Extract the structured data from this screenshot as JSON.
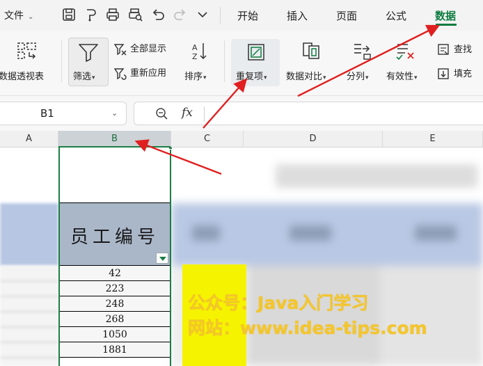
{
  "menubar": {
    "file_label": "文件",
    "tabs": [
      {
        "label": "开始"
      },
      {
        "label": "插入"
      },
      {
        "label": "页面"
      },
      {
        "label": "公式"
      },
      {
        "label": "数据",
        "active": true
      }
    ]
  },
  "ribbon": {
    "pivot_label": "数据透视表",
    "filter_label": "筛选",
    "show_all_label": "全部显示",
    "reapply_label": "重新应用",
    "sort_label": "排序",
    "duplicate_label": "重复项",
    "compare_label": "数据对比",
    "split_label": "分列",
    "validity_label": "有效性",
    "lookup_label": "查找",
    "fill_label": "填充"
  },
  "formula_bar": {
    "cell_ref": "B1",
    "fx_label": "fx"
  },
  "columns": [
    "A",
    "B",
    "C",
    "D",
    "E"
  ],
  "sheet": {
    "header_text": "员工编号",
    "values": [
      "42",
      "223",
      "248",
      "268",
      "1050",
      "1881"
    ]
  },
  "watermark": {
    "line1": "公众号：Java入门学习",
    "line2": "网站：www.idea-tips.com"
  },
  "colors": {
    "accent": "#0c7c3f",
    "arrow": "#e02020",
    "header_fill": "#aab7c9",
    "highlight_yellow": "#f6f300",
    "watermark": "#f4c62e"
  }
}
